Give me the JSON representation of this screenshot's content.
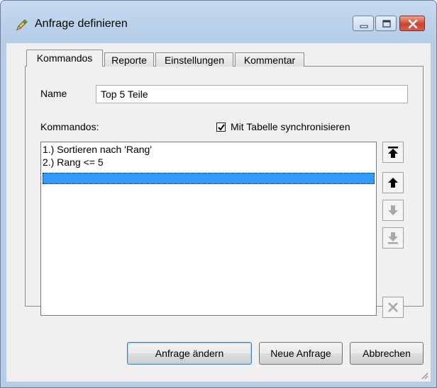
{
  "window": {
    "title": "Anfrage definieren",
    "icon": "pencil-icon",
    "buttons": [
      "minimize-icon",
      "maximize-icon",
      "close-icon"
    ]
  },
  "tabs": [
    {
      "label": "Kommandos",
      "active": true
    },
    {
      "label": "Reporte",
      "active": false
    },
    {
      "label": "Einstellungen",
      "active": false
    },
    {
      "label": "Kommentar",
      "active": false
    }
  ],
  "form": {
    "name_label": "Name",
    "name_value": "Top 5 Teile",
    "commands_label": "Kommandos:",
    "sync_label": "Mit Tabelle synchronisieren",
    "sync_checked": true
  },
  "commands": [
    "1.) Sortieren nach 'Rang'",
    "2.) Rang <= 5",
    ""
  ],
  "side_buttons": [
    "move-to-top-icon",
    "move-up-icon",
    "move-down-icon",
    "move-to-bottom-icon",
    "delete-icon"
  ],
  "footer": {
    "change_label": "Anfrage ändern",
    "new_label": "Neue Anfrage",
    "cancel_label": "Abbrechen"
  },
  "colors": {
    "selection": "#3399ff",
    "close_button": "#c9452c",
    "frame": "#b9d0ea"
  }
}
